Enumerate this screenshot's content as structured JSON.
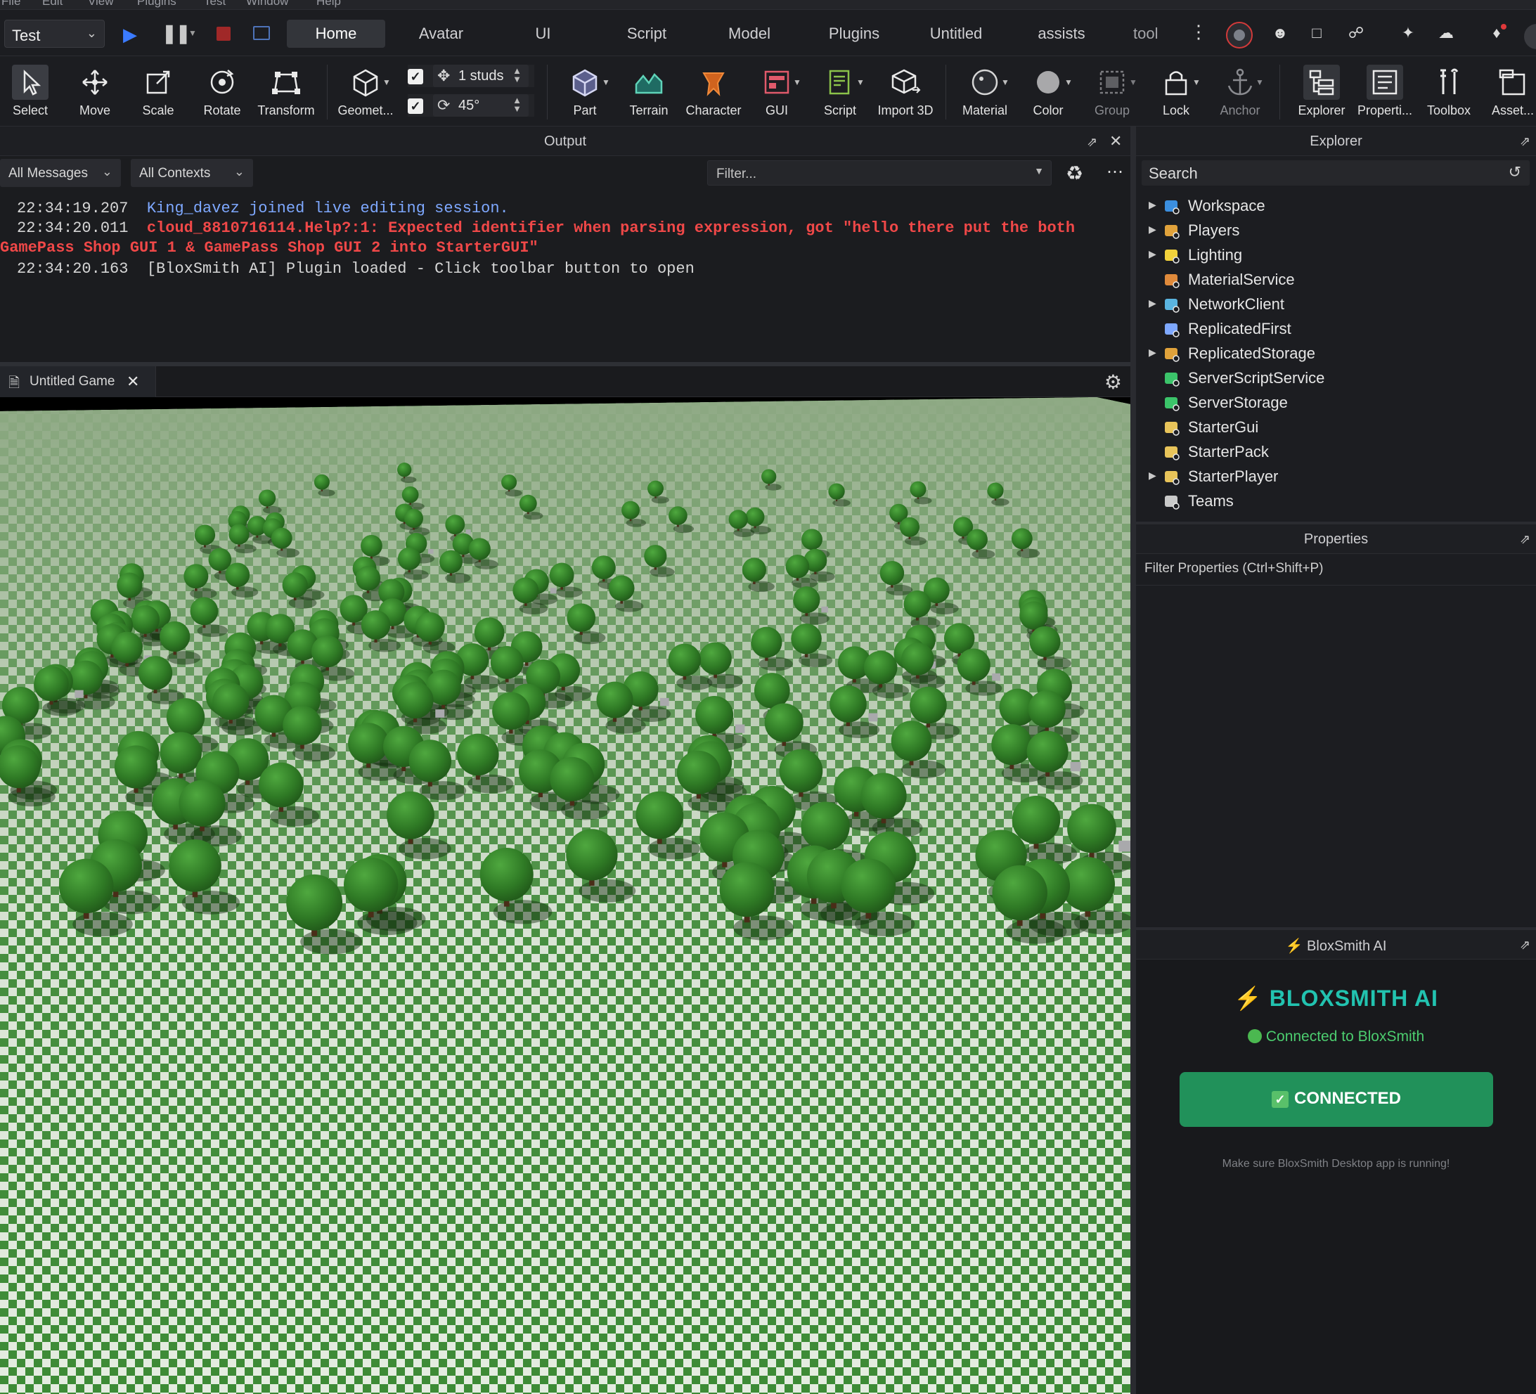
{
  "menu": [
    "File",
    "Edit",
    "View",
    "Plugins",
    "Test",
    "Window",
    "Help"
  ],
  "play": {
    "mode": "Test"
  },
  "tabs": [
    "Home",
    "Avatar",
    "UI",
    "Script",
    "Model",
    "Plugins",
    "Untitled",
    "assists",
    "tool"
  ],
  "active_tab": "Home",
  "toolbar": {
    "select": "Select",
    "move": "Move",
    "scale": "Scale",
    "rotate": "Rotate",
    "transform": "Transform",
    "geometry": "Geomet...",
    "move_snap": "1 studs",
    "rotate_snap": "45°",
    "part": "Part",
    "terrain": "Terrain",
    "character": "Character",
    "gui": "GUI",
    "script": "Script",
    "import3d": "Import 3D",
    "material": "Material",
    "color": "Color",
    "group": "Group",
    "lock": "Lock",
    "anchor": "Anchor",
    "explorer": "Explorer",
    "properties": "Properti...",
    "toolbox": "Toolbox",
    "assets": "Asset..."
  },
  "output": {
    "title": "Output",
    "messages_filter": "All Messages",
    "contexts_filter": "All Contexts",
    "filter_placeholder": "Filter...",
    "logs": [
      {
        "time": "22:34:19.207",
        "text": "King_davez joined live editing session."
      },
      {
        "time": "22:34:20.011",
        "text": "cloud_8810716114.Help?:1: Expected identifier when parsing expression, got \"hello there put the both",
        "cont": "GamePass Shop GUI 1 & GamePass Shop GUI 2 into StarterGUI\""
      },
      {
        "time": "22:34:20.163",
        "text": "[BloxSmith AI] Plugin loaded - Click toolbar button to open"
      }
    ]
  },
  "viewport": {
    "tab": "Untitled Game"
  },
  "explorer": {
    "title": "Explorer",
    "search": "Search",
    "items": [
      {
        "label": "Workspace",
        "icon": "globe-icon",
        "expand": true
      },
      {
        "label": "Players",
        "icon": "players-icon",
        "expand": true
      },
      {
        "label": "Lighting",
        "icon": "lightbulb-icon",
        "expand": true
      },
      {
        "label": "MaterialService",
        "icon": "material-service-icon",
        "expand": false
      },
      {
        "label": "NetworkClient",
        "icon": "network-icon",
        "expand": true
      },
      {
        "label": "ReplicatedFirst",
        "icon": "replicated-first-icon",
        "expand": false
      },
      {
        "label": "ReplicatedStorage",
        "icon": "replicated-storage-icon",
        "expand": true
      },
      {
        "label": "ServerScriptService",
        "icon": "server-script-icon",
        "expand": false
      },
      {
        "label": "ServerStorage",
        "icon": "server-storage-icon",
        "expand": false
      },
      {
        "label": "StarterGui",
        "icon": "starter-gui-icon",
        "expand": false
      },
      {
        "label": "StarterPack",
        "icon": "starter-pack-icon",
        "expand": false
      },
      {
        "label": "StarterPlayer",
        "icon": "starter-player-icon",
        "expand": true
      },
      {
        "label": "Teams",
        "icon": "teams-icon",
        "expand": false
      }
    ]
  },
  "properties": {
    "title": "Properties",
    "filter": "Filter Properties (Ctrl+Shift+P)"
  },
  "bloxsmith": {
    "header": "BloxSmith AI",
    "title": "BLOXSMITH AI",
    "status": "Connected to BloxSmith",
    "button": "CONNECTED",
    "hint": "Make sure BloxSmith Desktop app is running!"
  },
  "colors": {
    "accent_teal": "#22c3b0",
    "connected_green": "#21915a",
    "error_red": "#f04848",
    "info_blue": "#7ea8ff"
  }
}
